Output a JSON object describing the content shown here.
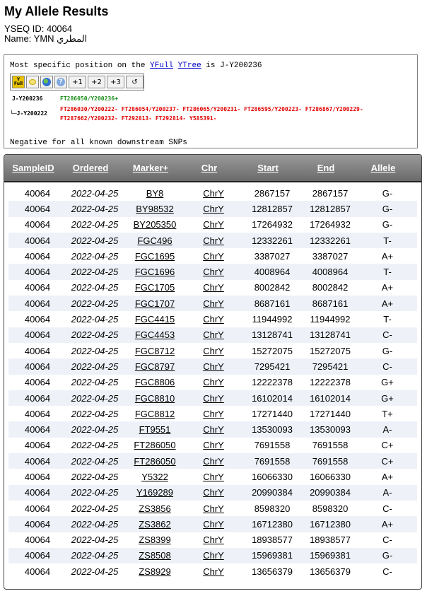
{
  "page": {
    "title": "My Allele Results",
    "yseq_id_line": "YSEQ ID: 40064",
    "name_line": "Name: YMN المطري"
  },
  "panel": {
    "position_prefix": "Most specific position on the ",
    "yfull_link": "YFull",
    "ytree_link": "YTree",
    "position_suffix": " is J-Y200236",
    "toolbar": {
      "yfull_icon_top": "Y",
      "yfull_icon_bottom": "Full",
      "btn_plus1": "+1",
      "btn_plus2": "+2",
      "btn_plus3": "+3",
      "btn_reset": "↺"
    },
    "tree": {
      "node1_name": "J-Y200236",
      "node1_snps": "FT286050/Y200236+",
      "node2_name": "└─J-Y200222",
      "node2_snps_line1": "FT286030/Y200222-  FT286054/Y200237-  FT286065/Y200231-  FT286595/Y200223-  FT286867/Y200229-",
      "node2_snps_line2": "FT287662/Y200232-  FT292813-  FT292814-  Y585391-"
    },
    "negative_text": "Negative for all known downstream SNPs"
  },
  "table": {
    "headers": [
      "SampleID",
      "Ordered",
      "Marker+",
      "Chr",
      "Start",
      "End",
      "Allele"
    ],
    "rows": [
      [
        "40064",
        "2022-04-25",
        "BY8",
        "ChrY",
        "2867157",
        "2867157",
        "G-"
      ],
      [
        "40064",
        "2022-04-25",
        "BY98532",
        "ChrY",
        "12812857",
        "12812857",
        "G-"
      ],
      [
        "40064",
        "2022-04-25",
        "BY205350",
        "ChrY",
        "17264932",
        "17264932",
        "G-"
      ],
      [
        "40064",
        "2022-04-25",
        "FGC496",
        "ChrY",
        "12332261",
        "12332261",
        "T-"
      ],
      [
        "40064",
        "2022-04-25",
        "FGC1695",
        "ChrY",
        "3387027",
        "3387027",
        "A+"
      ],
      [
        "40064",
        "2022-04-25",
        "FGC1696",
        "ChrY",
        "4008964",
        "4008964",
        "T-"
      ],
      [
        "40064",
        "2022-04-25",
        "FGC1705",
        "ChrY",
        "8002842",
        "8002842",
        "A+"
      ],
      [
        "40064",
        "2022-04-25",
        "FGC1707",
        "ChrY",
        "8687161",
        "8687161",
        "A+"
      ],
      [
        "40064",
        "2022-04-25",
        "FGC4415",
        "ChrY",
        "11944992",
        "11944992",
        "T-"
      ],
      [
        "40064",
        "2022-04-25",
        "FGC4453",
        "ChrY",
        "13128741",
        "13128741",
        "C-"
      ],
      [
        "40064",
        "2022-04-25",
        "FGC8712",
        "ChrY",
        "15272075",
        "15272075",
        "G-"
      ],
      [
        "40064",
        "2022-04-25",
        "FGC8797",
        "ChrY",
        "7295421",
        "7295421",
        "C-"
      ],
      [
        "40064",
        "2022-04-25",
        "FGC8806",
        "ChrY",
        "12222378",
        "12222378",
        "G+"
      ],
      [
        "40064",
        "2022-04-25",
        "FGC8810",
        "ChrY",
        "16102014",
        "16102014",
        "G+"
      ],
      [
        "40064",
        "2022-04-25",
        "FGC8812",
        "ChrY",
        "17271440",
        "17271440",
        "T+"
      ],
      [
        "40064",
        "2022-04-25",
        "FT9551",
        "ChrY",
        "13530093",
        "13530093",
        "A-"
      ],
      [
        "40064",
        "2022-04-25",
        "FT286050",
        "ChrY",
        "7691558",
        "7691558",
        "C+"
      ],
      [
        "40064",
        "2022-04-25",
        "FT286050",
        "ChrY",
        "7691558",
        "7691558",
        "C+"
      ],
      [
        "40064",
        "2022-04-25",
        "Y5322",
        "ChrY",
        "16066330",
        "16066330",
        "A+"
      ],
      [
        "40064",
        "2022-04-25",
        "Y169289",
        "ChrY",
        "20990384",
        "20990384",
        "A-"
      ],
      [
        "40064",
        "2022-04-25",
        "ZS3856",
        "ChrY",
        "8598320",
        "8598320",
        "C-"
      ],
      [
        "40064",
        "2022-04-25",
        "ZS3862",
        "ChrY",
        "16712380",
        "16712380",
        "A+"
      ],
      [
        "40064",
        "2022-04-25",
        "ZS8399",
        "ChrY",
        "18938577",
        "18938577",
        "C-"
      ],
      [
        "40064",
        "2022-04-25",
        "ZS8508",
        "ChrY",
        "15969381",
        "15969381",
        "G-"
      ],
      [
        "40064",
        "2022-04-25",
        "ZS8929",
        "ChrY",
        "13656379",
        "13656379",
        "C-"
      ]
    ]
  }
}
